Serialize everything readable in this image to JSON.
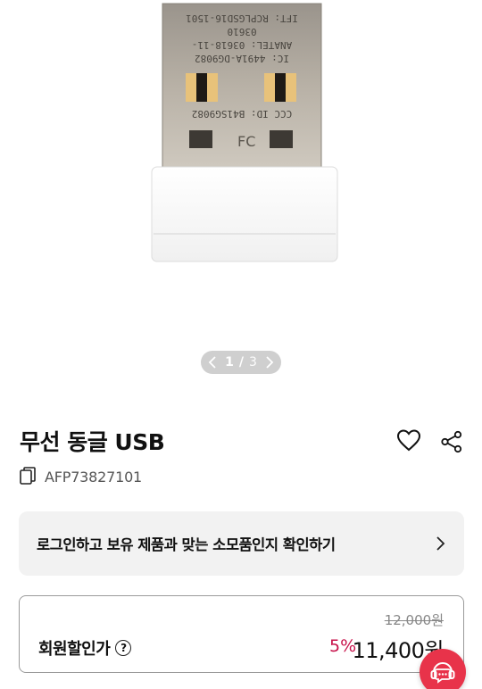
{
  "gallery": {
    "current_page": "1",
    "separator": "/",
    "total_pages": "3",
    "dongle_print": {
      "line1": "IFT: RCPLGSD16-1501",
      "line2": "03610",
      "line3": "ANATEL: 03618-11-",
      "line4": "IC: 4491A-DG9082",
      "line5": "CCC ID: B41SG9082",
      "fcc": "FC"
    }
  },
  "product": {
    "title": "무선 동글 USB",
    "sku": "AFP73827101"
  },
  "login_banner": {
    "text": "로그인하고 보유 제품과 맞는 소모품인지 확인하기"
  },
  "price": {
    "original": "12,000원",
    "member_label": "회원할인가",
    "help": "?",
    "discount": "5%",
    "sale": "11,400원"
  },
  "colors": {
    "discount": "#c7114a",
    "chat_button": "#e8334a",
    "pager_bg": "#cfcfcf"
  },
  "icons": {
    "wish": "heart-icon",
    "share": "share-icon",
    "copy": "copy-icon",
    "chevron": "chevron-right-icon",
    "chat": "chat-headset-icon"
  }
}
